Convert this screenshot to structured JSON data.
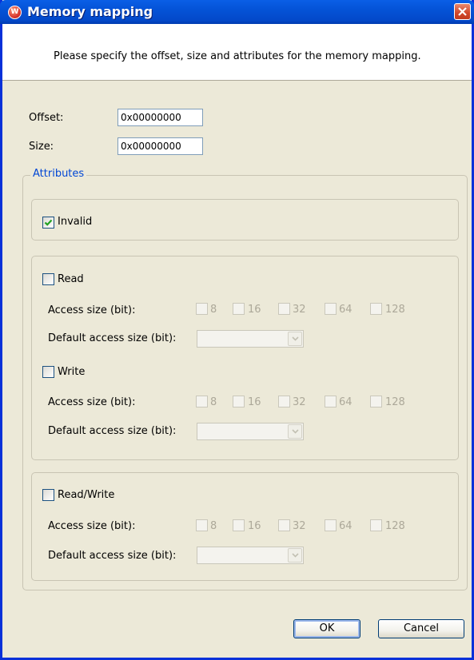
{
  "window": {
    "title": "Memory mapping"
  },
  "banner": {
    "text": "Please specify the offset, size and attributes for the memory mapping."
  },
  "fields": {
    "offset_label": "Offset:",
    "offset_value": "0x00000000",
    "size_label": "Size:",
    "size_value": "0x00000000"
  },
  "attributes": {
    "group_title": "Attributes",
    "invalid": {
      "label": "Invalid",
      "checked": true
    },
    "read": {
      "label": "Read",
      "checked": false,
      "access_label": "Access size (bit):",
      "default_label": "Default access size (bit):",
      "sizes": [
        "8",
        "16",
        "32",
        "64",
        "128"
      ],
      "default_value": ""
    },
    "write": {
      "label": "Write",
      "checked": false,
      "access_label": "Access size (bit):",
      "default_label": "Default access size (bit):",
      "sizes": [
        "8",
        "16",
        "32",
        "64",
        "128"
      ],
      "default_value": ""
    },
    "readwrite": {
      "label": "Read/Write",
      "checked": false,
      "access_label": "Access size (bit):",
      "default_label": "Default access size (bit):",
      "sizes": [
        "8",
        "16",
        "32",
        "64",
        "128"
      ],
      "default_value": ""
    }
  },
  "buttons": {
    "ok": "OK",
    "cancel": "Cancel"
  }
}
